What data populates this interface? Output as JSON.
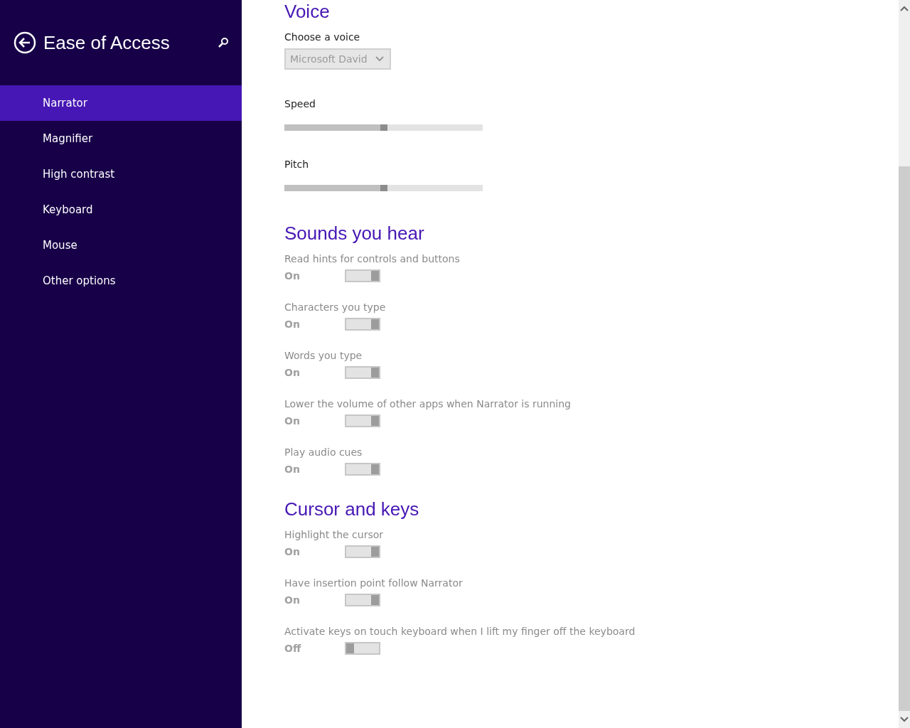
{
  "sidebar": {
    "title": "Ease of Access",
    "items": [
      {
        "label": "Narrator",
        "selected": true
      },
      {
        "label": "Magnifier",
        "selected": false
      },
      {
        "label": "High contrast",
        "selected": false
      },
      {
        "label": "Keyboard",
        "selected": false
      },
      {
        "label": "Mouse",
        "selected": false
      },
      {
        "label": "Other options",
        "selected": false
      }
    ]
  },
  "sections": [
    {
      "title": "Voice",
      "items": [
        {
          "kind": "dropdown",
          "label": "Choose a voice",
          "value": "Microsoft David",
          "disabled": true
        },
        {
          "kind": "slider",
          "label": "Speed",
          "level": 0.5
        },
        {
          "kind": "slider",
          "label": "Pitch",
          "level": 0.5
        }
      ]
    },
    {
      "title": "Sounds you hear",
      "items": [
        {
          "kind": "toggle",
          "label": "Read hints for controls and buttons",
          "state": "On",
          "on": true,
          "disabled": true
        },
        {
          "kind": "toggle",
          "label": "Characters you type",
          "state": "On",
          "on": true,
          "disabled": true
        },
        {
          "kind": "toggle",
          "label": "Words you type",
          "state": "On",
          "on": true,
          "disabled": true
        },
        {
          "kind": "toggle",
          "label": "Lower the volume of other apps when Narrator is running",
          "state": "On",
          "on": true,
          "disabled": true
        },
        {
          "kind": "toggle",
          "label": "Play audio cues",
          "state": "On",
          "on": true,
          "disabled": true
        }
      ]
    },
    {
      "title": "Cursor and keys",
      "items": [
        {
          "kind": "toggle",
          "label": "Highlight the cursor",
          "state": "On",
          "on": true,
          "disabled": true
        },
        {
          "kind": "toggle",
          "label": "Have insertion point follow Narrator",
          "state": "On",
          "on": true,
          "disabled": true
        },
        {
          "kind": "toggle",
          "label": "Activate keys on touch keyboard when I lift my finger off the keyboard",
          "state": "Off",
          "on": false,
          "disabled": true
        }
      ]
    }
  ]
}
